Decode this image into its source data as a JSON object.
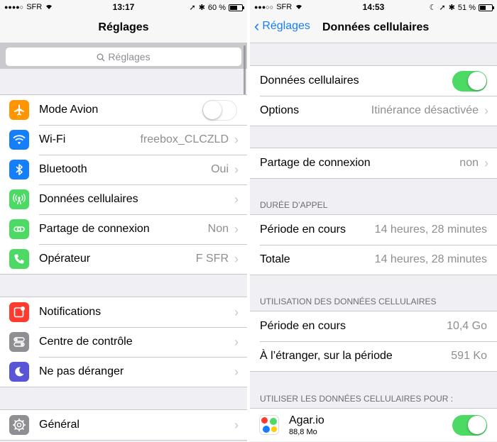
{
  "left": {
    "status": {
      "carrier": "SFR",
      "time": "13:17",
      "battery": "60 %",
      "battery_level": 0.6
    },
    "nav_title": "Réglages",
    "search_placeholder": "Réglages",
    "groups": [
      [
        {
          "label": "Mode Avion",
          "icon": "airplane-icon",
          "color": "#ff9500",
          "toggle": "off"
        },
        {
          "label": "Wi-Fi",
          "icon": "wifi-icon",
          "color": "#157efb",
          "value": "freebox_CLCZLD"
        },
        {
          "label": "Bluetooth",
          "icon": "bluetooth-icon",
          "color": "#157efb",
          "value": "Oui"
        },
        {
          "label": "Données cellulaires",
          "icon": "cellular-antenna-icon",
          "color": "#4cd964",
          "value": ""
        },
        {
          "label": "Partage de connexion",
          "icon": "hotspot-chain-icon",
          "color": "#4cd964",
          "value": "Non"
        },
        {
          "label": "Opérateur",
          "icon": "phone-icon",
          "color": "#4cd964",
          "value": "F SFR"
        }
      ],
      [
        {
          "label": "Notifications",
          "icon": "notifications-icon",
          "color": "#ff3b30",
          "value": ""
        },
        {
          "label": "Centre de contrôle",
          "icon": "control-center-icon",
          "color": "#8e8e93",
          "value": ""
        },
        {
          "label": "Ne pas déranger",
          "icon": "moon-icon",
          "color": "#5856d6",
          "value": ""
        }
      ],
      [
        {
          "label": "Général",
          "icon": "gear-icon",
          "color": "#8e8e93",
          "value": ""
        }
      ]
    ]
  },
  "right": {
    "status": {
      "carrier": "SFR",
      "time": "14:53",
      "battery": "51 %",
      "battery_level": 0.51
    },
    "back_label": "Réglages",
    "nav_title": "Données cellulaires",
    "group1": [
      {
        "label": "Données cellulaires",
        "toggle": "on"
      },
      {
        "label": "Options",
        "value": "Itinérance désactivée"
      }
    ],
    "group2": [
      {
        "label": "Partage de connexion",
        "value": "non"
      }
    ],
    "section_call": "DURÉE D’APPEL",
    "call_rows": [
      {
        "label": "Période en cours",
        "value": "14 heures, 28 minutes"
      },
      {
        "label": "Totale",
        "value": "14 heures, 28 minutes"
      }
    ],
    "section_usage": "UTILISATION DES DONNÉES CELLULAIRES",
    "usage_rows": [
      {
        "label": "Période en cours",
        "value": "10,4 Go"
      },
      {
        "label": "À l’étranger, sur la période",
        "value": "591 Ko"
      }
    ],
    "section_apps": "UTILISER LES DONNÉES CELLULAIRES POUR :",
    "apps": [
      {
        "name": "Agar.io",
        "size": "88,8 Mo",
        "toggle": "on"
      }
    ]
  }
}
